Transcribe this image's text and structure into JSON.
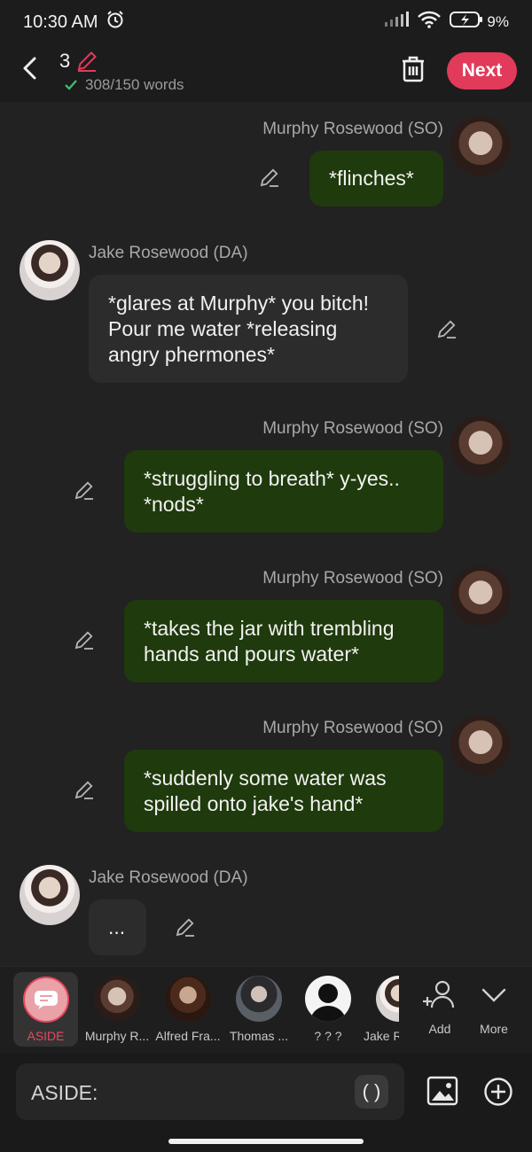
{
  "status_bar": {
    "time": "10:30 AM",
    "battery": "9%"
  },
  "header": {
    "message_number": "3",
    "word_count": "308/150 words",
    "next_label": "Next"
  },
  "messages": [
    {
      "sender": "Murphy Rosewood (SO)",
      "text": "*flinches*"
    },
    {
      "sender": "Jake Rosewood (DA)",
      "text": "*glares at Murphy* you bitch! Pour me water *releasing angry phermones*"
    },
    {
      "sender": "Murphy Rosewood (SO)",
      "text": "*struggling to breath* y-yes.. *nods*"
    },
    {
      "sender": "Murphy Rosewood (SO)",
      "text": "*takes the jar with trembling hands and pours water*"
    },
    {
      "sender": "Murphy Rosewood (SO)",
      "text": "*suddenly some water was spilled onto jake's hand*"
    },
    {
      "sender": "Jake Rosewood (DA)",
      "text": "..."
    }
  ],
  "character_bar": {
    "aside_label": "ASIDE",
    "characters": [
      "Murphy R...",
      "Alfred Fra...",
      "Thomas ...",
      "? ? ?",
      "Jake R"
    ],
    "add_label": "Add",
    "more_label": "More"
  },
  "composer": {
    "text": "ASIDE:",
    "paren_label": "( )"
  },
  "colors": {
    "accent": "#e23a5a",
    "bubble_green": "#1f3a0c",
    "bubble_dark": "#2c2c2c",
    "background": "#222222"
  }
}
